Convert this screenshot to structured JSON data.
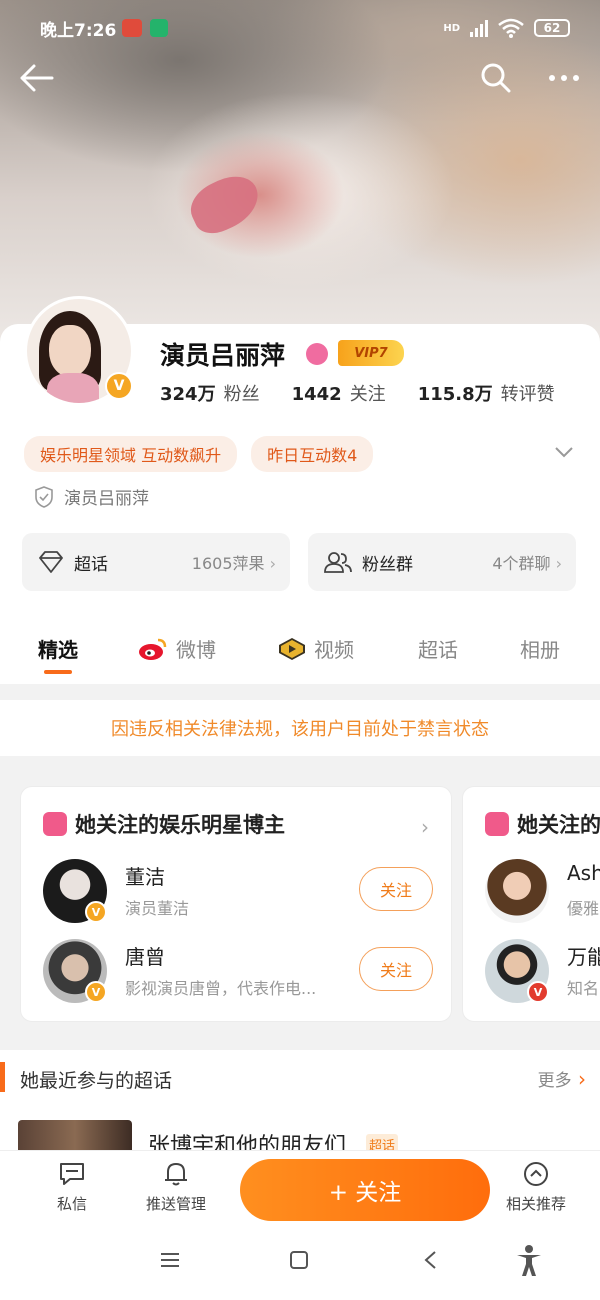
{
  "status_bar": {
    "time": "晚上7:26",
    "network": "HD",
    "battery": "62"
  },
  "profile": {
    "name": "演员吕丽萍",
    "vip_label": "VIP7",
    "avatar_v": "V",
    "stats": [
      {
        "value": "324万",
        "label": "粉丝"
      },
      {
        "value": "1442",
        "label": "关注"
      },
      {
        "value": "115.8万",
        "label": "转评赞"
      }
    ],
    "tags": [
      "娱乐明星领域 互动数飙升",
      "昨日互动数4"
    ],
    "verify_text": "演员吕丽萍"
  },
  "boxes": {
    "super": {
      "label": "超话",
      "value": "1605萍果"
    },
    "fans": {
      "label": "粉丝群",
      "value": "4个群聊"
    }
  },
  "tabs": [
    "精选",
    "微博",
    "视频",
    "超话",
    "相册"
  ],
  "notice": "因违反相关法律法规，该用户目前处于禁言状态",
  "recommend": {
    "title": "她关注的娱乐明星博主",
    "follow_label": "关注",
    "people": [
      {
        "name": "董洁",
        "desc": "演员董洁"
      },
      {
        "name": "唐曾",
        "desc": "影视演员唐曾，代表作电..."
      }
    ],
    "second_card": {
      "title": "她关注的",
      "people": [
        {
          "name": "Ash",
          "desc": "優雅"
        },
        {
          "name": "万能",
          "desc": "知名"
        }
      ]
    }
  },
  "supertopic": {
    "heading": "她最近参与的超话",
    "more": "更多",
    "item_title": "张博宇和他的朋友们",
    "item_tag": "超话"
  },
  "bottom_bar": {
    "message": "私信",
    "push": "推送管理",
    "follow": "+ 关注",
    "related": "相关推荐"
  },
  "colors": {
    "accent": "#f86b1a",
    "tag_text": "#e0591a",
    "notice": "#f08a2a"
  }
}
